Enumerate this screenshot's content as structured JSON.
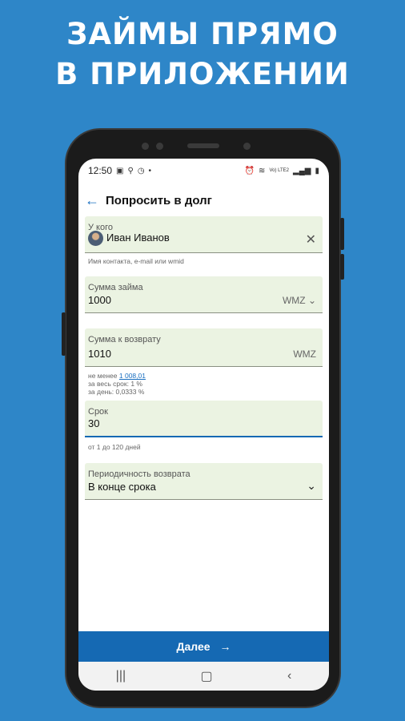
{
  "promo": {
    "line1": "ЗАЙМЫ ПРЯМО",
    "line2": "В ПРИЛОЖЕНИИ"
  },
  "status_bar": {
    "time": "12:50",
    "dot": "•",
    "network": "Vo) LTE2"
  },
  "app_bar": {
    "title": "Попросить в долг"
  },
  "fields": {
    "from": {
      "label": "У кого",
      "value": "Иван Иванов",
      "hint": "Имя контакта, e-mail или wmid"
    },
    "loan_amount": {
      "label": "Сумма займа",
      "value": "1000",
      "currency": "WMZ"
    },
    "repay_amount": {
      "label": "Сумма к возврату",
      "value": "1010",
      "currency": "WMZ",
      "hint_min_prefix": "не менее",
      "hint_min_value": "1 008,01",
      "hint_total": "за весь срок: 1 %",
      "hint_daily": "за день: 0,0333 %"
    },
    "term": {
      "label": "Срок",
      "value": "30",
      "hint": "от 1 до 120 дней"
    },
    "periodicity": {
      "label": "Периодичность возврата",
      "value": "В конце срока"
    }
  },
  "buttons": {
    "next": "Далее"
  },
  "accent": "#1569b3",
  "background": "#2e86c8"
}
